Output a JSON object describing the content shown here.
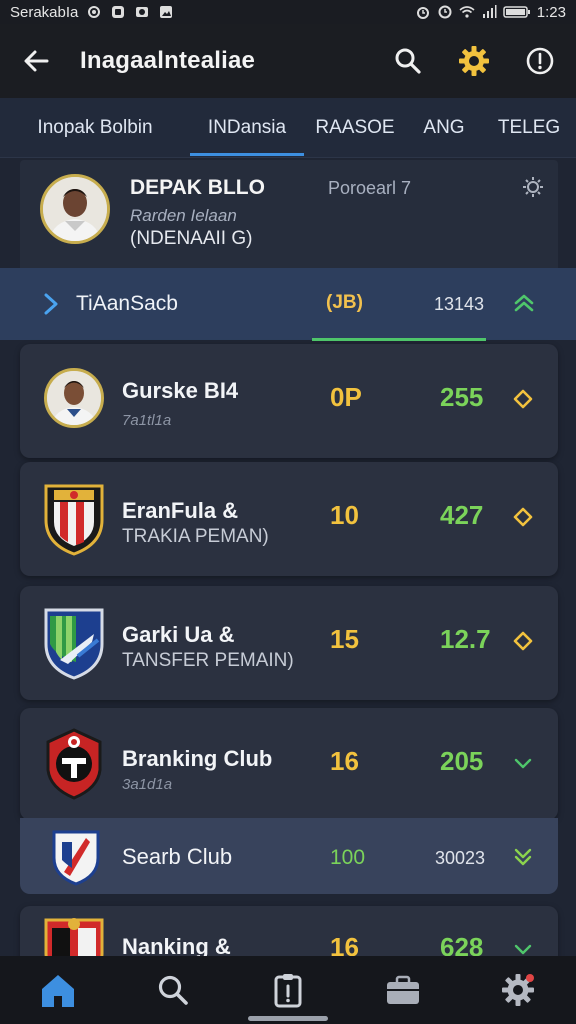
{
  "status_bar": {
    "carrier": "SerakabIa",
    "time": "1:23",
    "icons": [
      "settings-icon",
      "notification-icon",
      "camera-icon",
      "image-icon",
      "alarm-icon",
      "clock-icon",
      "wifi-icon",
      "signal-icon",
      "battery-icon"
    ]
  },
  "app_bar": {
    "title": "Inagaalntealiae",
    "icons": [
      "back-arrow-icon",
      "search-icon",
      "gear-icon",
      "info-icon"
    ]
  },
  "tabs": [
    {
      "label": "Inopak Bolbin",
      "active": false
    },
    {
      "label": "INDansia",
      "active": true
    },
    {
      "label": "RAASOE",
      "active": false
    },
    {
      "label": "ANG",
      "active": false
    },
    {
      "label": "TELEG",
      "active": false
    }
  ],
  "profile": {
    "name": "DEPAK BLLO",
    "subtitle": "Rarden Ielaan",
    "country": "(NDENAAII G)",
    "position": "Poroearl 7"
  },
  "highlight": {
    "label": "TiAanSacb",
    "score": "(JB)",
    "points": "13143"
  },
  "cards": [
    {
      "name": "Gurske BI4",
      "sub": "7a1tl1a",
      "rank": "0P",
      "points": "255",
      "trend": "diamond"
    },
    {
      "name": "EranFula &",
      "sub": "TRAKIA PEMAN)",
      "rank": "10",
      "points": "427",
      "trend": "diamond"
    },
    {
      "name": "Garki Ua &",
      "sub": "TANSFER PEMAIN)",
      "rank": "15",
      "points": "12.7",
      "trend": "diamond"
    },
    {
      "name": "Branking Club",
      "sub": "3a1d1a",
      "rank": "16",
      "points": "205",
      "trend": "down"
    }
  ],
  "search_row": {
    "name": "Searb Club",
    "rank": "100",
    "points": "30023"
  },
  "last_card": {
    "name": "Nanking &",
    "rank": "16",
    "points": "628"
  },
  "bottom_nav": [
    "home-icon",
    "search-icon",
    "clipboard-icon",
    "briefcase-icon",
    "settings-icon"
  ],
  "colors": {
    "accent_blue": "#3d8fe0",
    "rank_yellow": "#f2c23e",
    "points_green": "#7bd35a",
    "highlight_bg": "#2d3e5d"
  }
}
